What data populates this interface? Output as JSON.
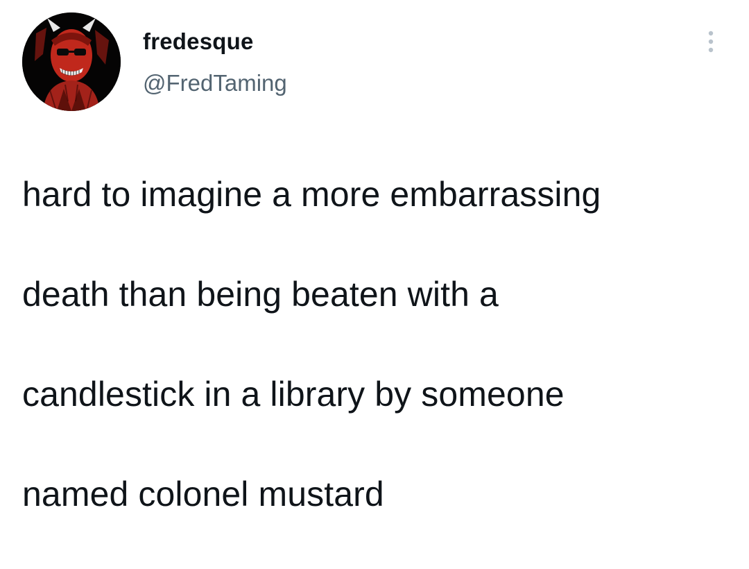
{
  "tweet": {
    "author": {
      "display_name": "fredesque",
      "handle": "@FredTaming",
      "avatar_icon": "red-devil-avatar"
    },
    "more_icon": "vertical-dots-icon",
    "text_lines": [
      "hard to imagine a more embarrassing",
      "death than being beaten with a",
      "candlestick in a library by someone",
      "named colonel mustard"
    ]
  },
  "colors": {
    "text": "#0f1419",
    "secondary_text": "#536471",
    "more_icon": "#b9c3cc",
    "avatar_red": "#c0281c",
    "background": "#ffffff"
  }
}
